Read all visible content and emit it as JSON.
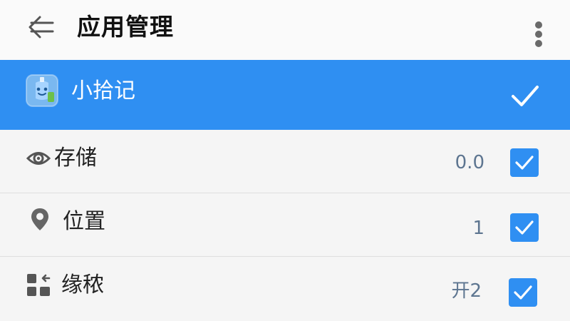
{
  "header": {
    "title": "应用管理",
    "back_icon": "arrow-left-icon",
    "more_icon": "more-vertical-icon"
  },
  "app": {
    "name": "小拾记",
    "icon": "app-icon-xiaoshiji",
    "selected": true
  },
  "permissions": [
    {
      "label": "存储",
      "value": "0.0",
      "icon": "storage-eye-icon",
      "checked": true
    },
    {
      "label": "位置",
      "value": "1",
      "icon": "location-pin-icon",
      "checked": true
    },
    {
      "label": "缘秾",
      "value": "开2",
      "icon": "widgets-icon",
      "checked": true
    }
  ],
  "colors": {
    "accent": "#2f8ff2",
    "background": "#f5f5f5",
    "value_text": "#5d7590"
  }
}
